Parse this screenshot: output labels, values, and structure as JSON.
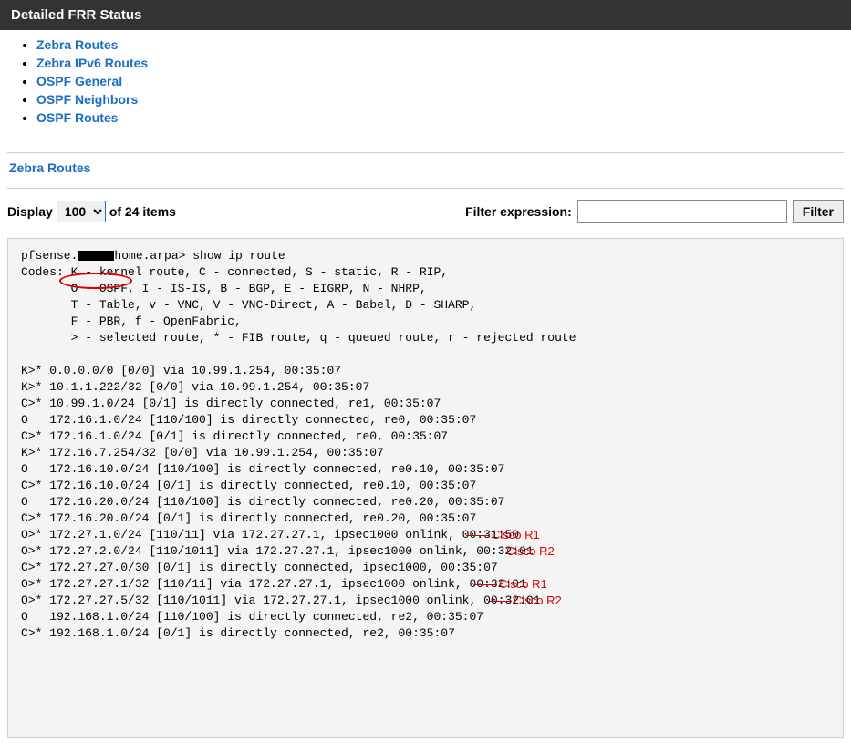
{
  "header": {
    "title": "Detailed FRR Status"
  },
  "nav": [
    "Zebra Routes",
    "Zebra IPv6 Routes",
    "OSPF General",
    "OSPF Neighbors",
    "OSPF Routes"
  ],
  "section": {
    "title": "Zebra Routes"
  },
  "controls": {
    "display_label": "Display",
    "display_value": "100",
    "of_text": "of 24 items",
    "filter_label": "Filter expression:",
    "filter_value": "",
    "filter_button": "Filter"
  },
  "terminal": {
    "hostname_prefix": "pfsense.",
    "hostname_suffix": "home.arpa>",
    "command": "show ip route",
    "codes_lines": [
      "Codes: K - kernel route, C - connected, S - static, R - RIP,",
      "       O - OSPF, I - IS-IS, B - BGP, E - EIGRP, N - NHRP,",
      "       T - Table, v - VNC, V - VNC-Direct, A - Babel, D - SHARP,",
      "       F - PBR, f - OpenFabric,",
      "       > - selected route, * - FIB route, q - queued route, r - rejected route"
    ],
    "routes": [
      "K>* 0.0.0.0/0 [0/0] via 10.99.1.254, 00:35:07",
      "K>* 10.1.1.222/32 [0/0] via 10.99.1.254, 00:35:07",
      "C>* 10.99.1.0/24 [0/1] is directly connected, re1, 00:35:07",
      "O   172.16.1.0/24 [110/100] is directly connected, re0, 00:35:07",
      "C>* 172.16.1.0/24 [0/1] is directly connected, re0, 00:35:07",
      "K>* 172.16.7.254/32 [0/0] via 10.99.1.254, 00:35:07",
      "O   172.16.10.0/24 [110/100] is directly connected, re0.10, 00:35:07",
      "C>* 172.16.10.0/24 [0/1] is directly connected, re0.10, 00:35:07",
      "O   172.16.20.0/24 [110/100] is directly connected, re0.20, 00:35:07",
      "C>* 172.16.20.0/24 [0/1] is directly connected, re0.20, 00:35:07",
      "O>* 172.27.1.0/24 [110/11] via 172.27.27.1, ipsec1000 onlink, 00:31:50",
      "O>* 172.27.2.0/24 [110/1011] via 172.27.27.1, ipsec1000 onlink, 00:32:01",
      "C>* 172.27.27.0/30 [0/1] is directly connected, ipsec1000, 00:35:07",
      "O>* 172.27.27.1/32 [110/11] via 172.27.27.1, ipsec1000 onlink, 00:32:01",
      "O>* 172.27.27.5/32 [110/1011] via 172.27.27.1, ipsec1000 onlink, 00:32:01",
      "O   192.168.1.0/24 [110/100] is directly connected, re2, 00:35:07",
      "C>* 192.168.1.0/24 [0/1] is directly connected, re2, 00:35:07"
    ]
  },
  "annotations": [
    {
      "text": "Cisco R1"
    },
    {
      "text": "Cisco R2"
    },
    {
      "text": "Cisco R1"
    },
    {
      "text": "Cisco R2"
    }
  ]
}
